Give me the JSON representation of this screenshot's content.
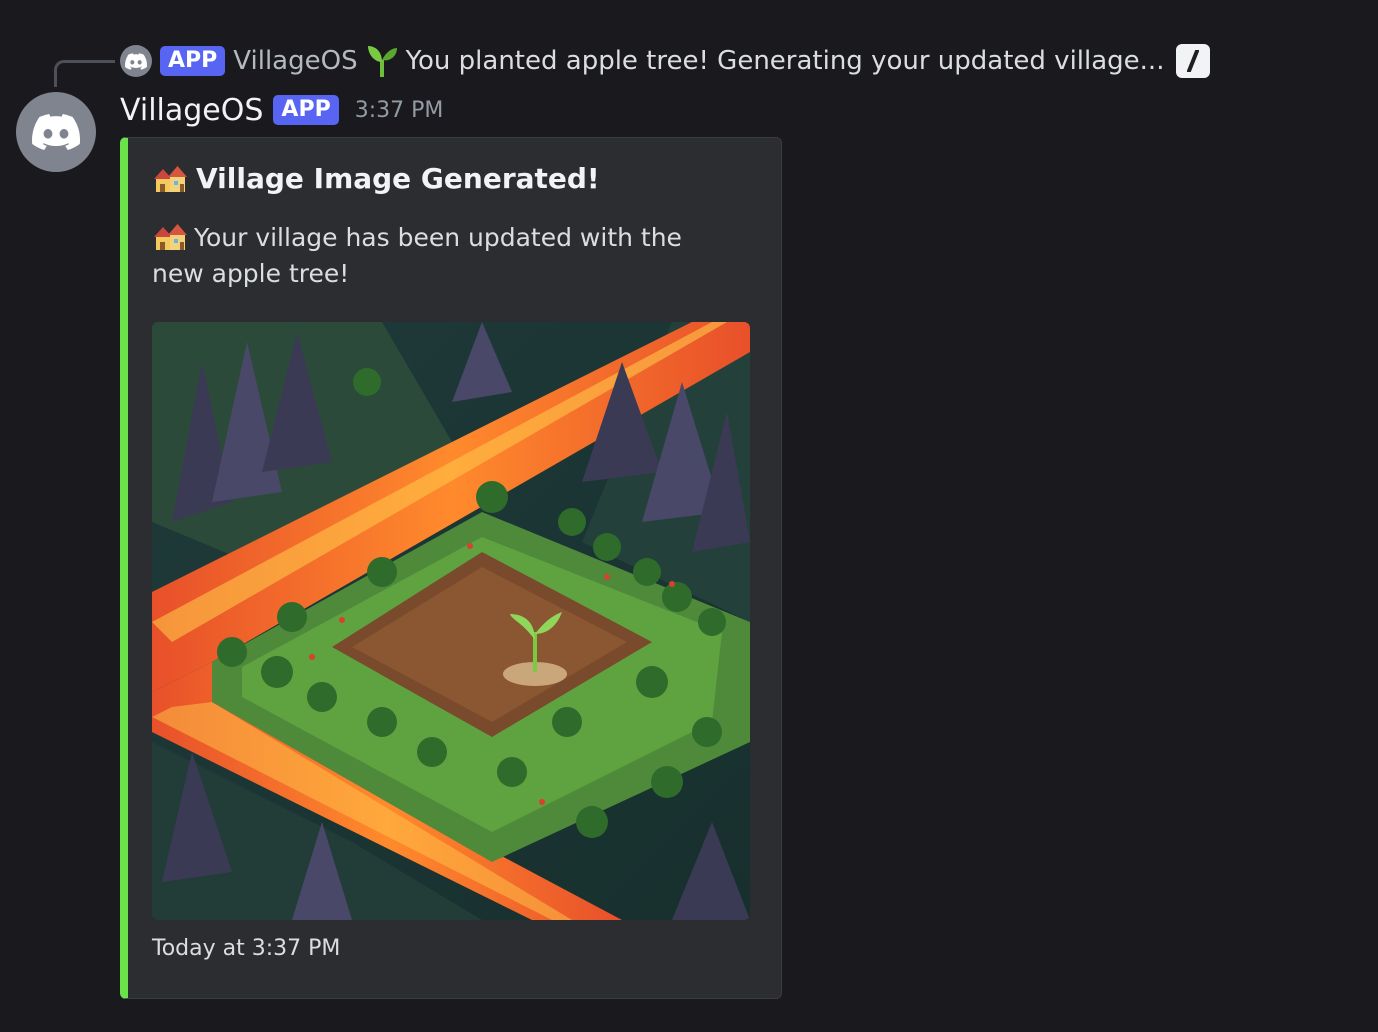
{
  "reply": {
    "badge": "APP",
    "author": "VillageOS",
    "text": "You planted apple tree! Generating your updated village..."
  },
  "message": {
    "author": "VillageOS",
    "badge": "APP",
    "timestamp": "3:37 PM"
  },
  "embed": {
    "accent_color": "#6be24a",
    "title": "Village Image Generated!",
    "description": "Your village has been updated with the new apple tree!",
    "image_icon": "village-pixel-art-image",
    "footer": "Today at 3:37 PM"
  },
  "colors": {
    "background": "#1a1a1e",
    "badge": "#5865f2",
    "embed_bg": "#2b2d31"
  }
}
